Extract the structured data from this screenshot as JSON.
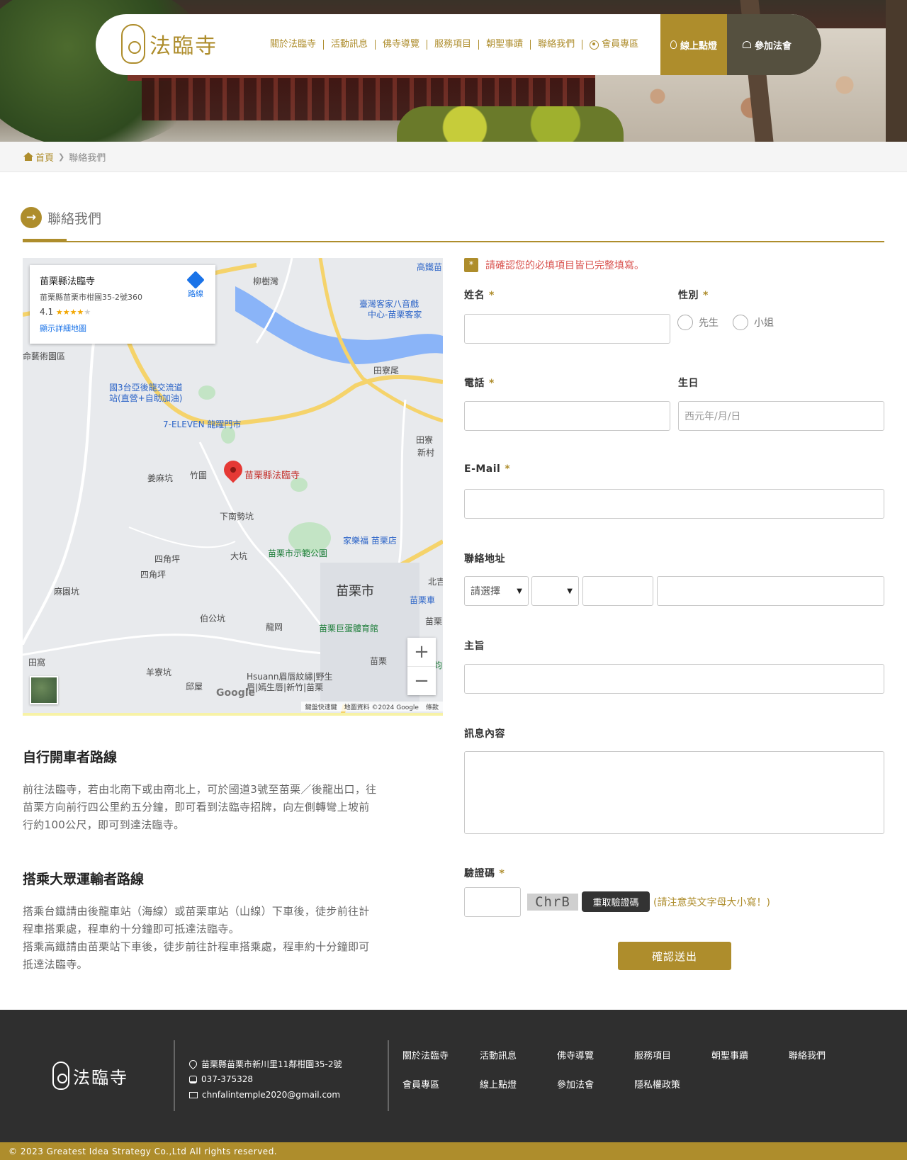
{
  "nav": {
    "logo_text": "法臨寺",
    "links": [
      "關於法臨寺",
      "活動訊息",
      "佛寺導覽",
      "服務項目",
      "朝聖事蹟",
      "聯絡我們"
    ],
    "member_label": "會員專區",
    "lamp_label": "線上點燈",
    "join_label": "參加法會"
  },
  "breadcrumb": {
    "home": "首頁",
    "current": "聯絡我們"
  },
  "page_title": "聯絡我們",
  "map": {
    "card_name": "苗栗縣法臨寺",
    "card_address": "苗栗縣苗栗市柑園35-2號360",
    "card_rating": "4.1",
    "card_stars": "★★★★",
    "card_star_empty": "★",
    "card_link": "顯示詳細地圖",
    "directions": "路線",
    "pin_label": "苗栗縣法臨寺",
    "labels": {
      "liushuwan": "柳樹灣",
      "hakka1": "臺灣客家八音戲",
      "hakka2": "中心-苗栗客家",
      "highrail": "高鐵苗",
      "arts": "命藝術園區",
      "interchange1": "國3台亞後龍交流道",
      "interchange2": "站(直營+自助加油)",
      "tianliaowei": "田寮尾",
      "seven": "7-ELEVEN 龍躍門市",
      "tianliao": "田寮",
      "xincun": "新村",
      "jiangmakeng": "姜麻坑",
      "zhuwei": "竹圍",
      "xianankeng": "下南勢坑",
      "carrefour": "家樂福 苗栗店",
      "park": "苗栗市示範公園",
      "sijiaoping1": "四角坪",
      "sijiaoping2": "四角坪",
      "dakeng": "大坑",
      "mahuakeng": "麻園坑",
      "miaolicity": "苗栗市",
      "bogongkeng": "伯公坑",
      "longgang": "龍岡",
      "stadium": "苗栗巨蛋體育館",
      "tianwo": "田窩",
      "yangliaokeng": "羊寮坑",
      "miaoli": "苗栗",
      "hsuann1": "Hsuann眉唇紋繡|野生",
      "hsuann2": "眉|嫣生唇|新竹|苗栗",
      "yiwu": "邱屋",
      "miaoli_station": "苗栗車",
      "miaoli_e": "苗栗",
      "beiji": "北吉",
      "jing": "鈞"
    },
    "google": "Google",
    "attrib_shortcuts": "鍵盤快速鍵",
    "attrib_data": "地圖資料 ©2024 Google",
    "attrib_terms": "條款"
  },
  "routes": [
    {
      "title": "自行開車者路線",
      "lines": [
        "前往法臨寺，若由北南下或由南北上，可於國道3號至苗栗／後龍出口，往",
        "苗栗方向前行四公里約五分鐘，即可看到法臨寺招牌，向左側轉彎上坡前",
        "行約100公尺，即可到達法臨寺。"
      ]
    },
    {
      "title": "搭乘大眾運輸者路線",
      "lines": [
        "搭乘台鐵請由後龍車站（海線）或苗栗車站（山線）下車後，徒步前往計",
        "程車搭乘處，程車約十分鐘即可抵達法臨寺。",
        "搭乘高鐵請由苗栗站下車後，徒步前往計程車搭乘處，程車約十分鐘即可",
        "抵達法臨寺。"
      ]
    }
  ],
  "form": {
    "notice": "請確認您的必填項目皆已完整填寫。",
    "notice_star": "*",
    "required_mark": "*",
    "name_label": "姓名",
    "gender_label": "性別",
    "gender_options": [
      "先生",
      "小姐"
    ],
    "phone_label": "電話",
    "birthday_label": "生日",
    "birthday_placeholder": "西元年/月/日",
    "email_label": "E-Mail",
    "address_label": "聯絡地址",
    "city_select": "請選擇",
    "district_select": "",
    "subject_label": "主旨",
    "message_label": "訊息內容",
    "captcha_label": "驗證碼",
    "captcha_text": "ChrB",
    "captcha_refresh": "重取驗證碼",
    "captcha_note": "(請注意英文字母大小寫！)",
    "submit": "確認送出"
  },
  "footer": {
    "logo_text": "法臨寺",
    "address": "苗栗縣苗栗市新川里11鄰柑園35-2號",
    "phone": "037-375328",
    "email": "chnfalintemple2020@gmail.com",
    "links": [
      "關於法臨寺",
      "活動訊息",
      "佛寺導覽",
      "服務項目",
      "朝聖事蹟",
      "聯絡我們",
      "會員專區",
      "線上點燈",
      "參加法會",
      "隱私權政策"
    ],
    "copyright": "© 2023 Greatest Idea Strategy Co.,Ltd All rights reserved."
  },
  "colors": {
    "accent": "#ae8d2c",
    "dark": "#55503f",
    "footer_bg": "#2f2f2f",
    "error": "#d9534f"
  }
}
